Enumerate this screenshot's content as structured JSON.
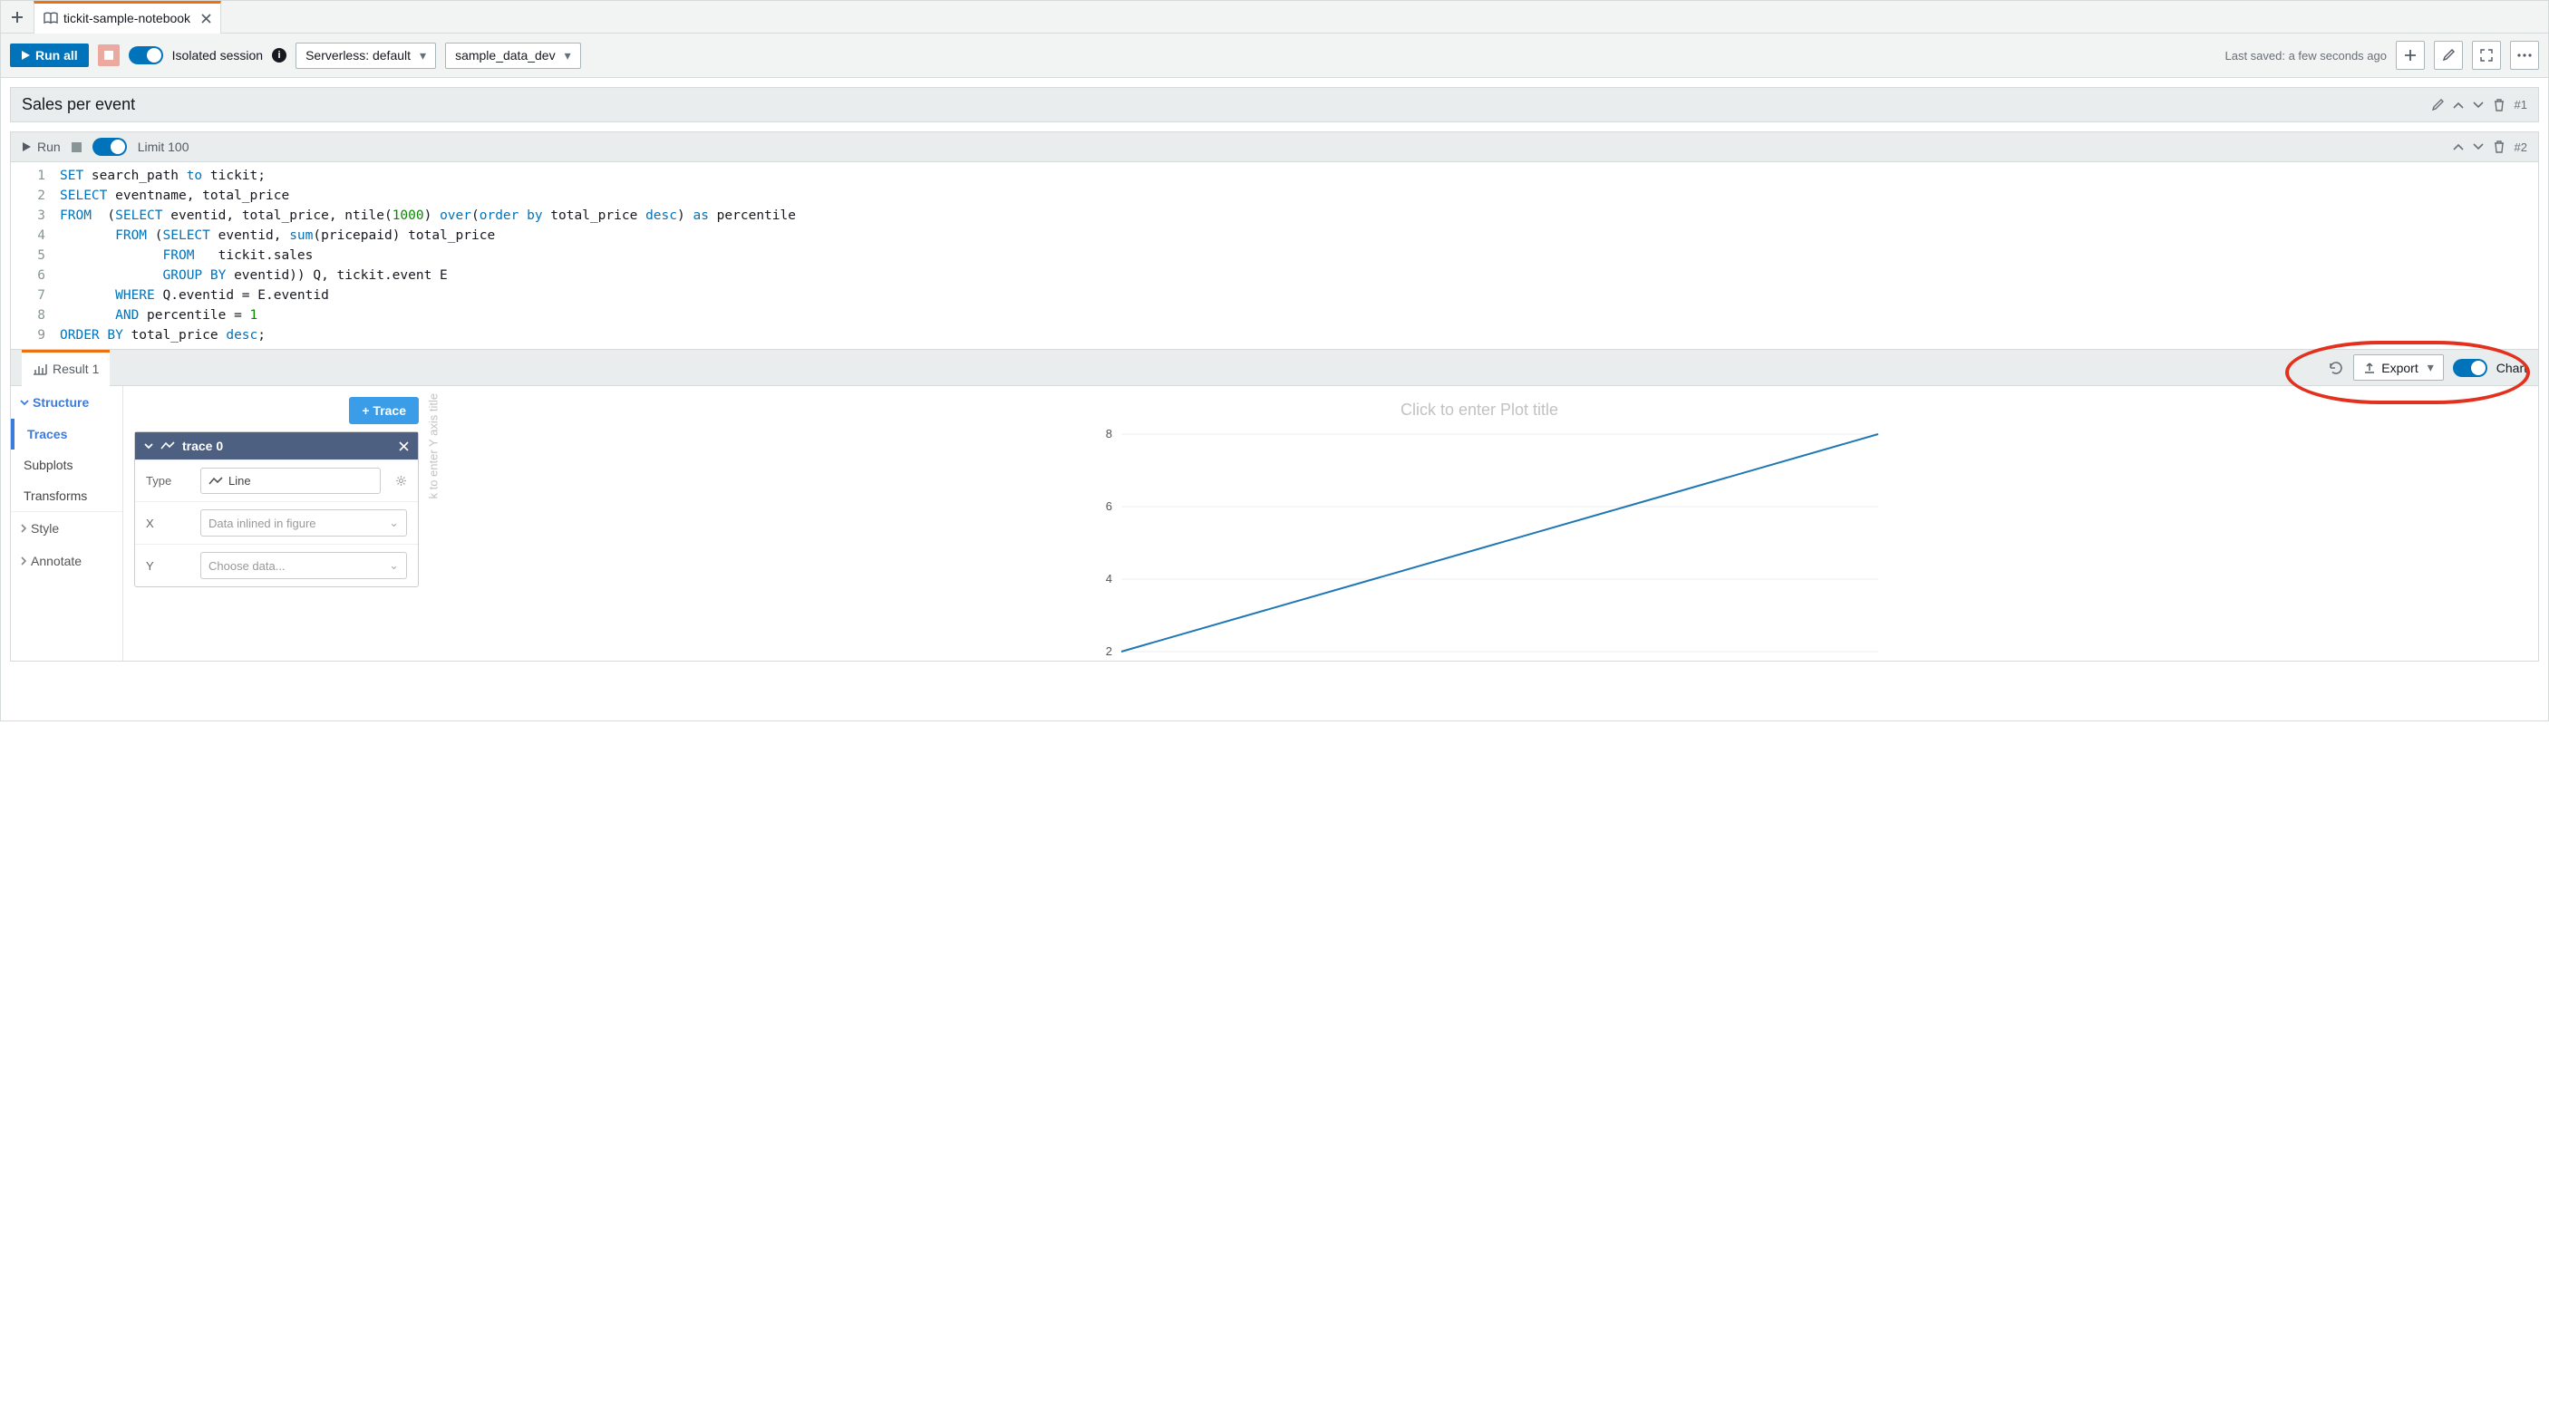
{
  "tab": {
    "name": "tickit-sample-notebook"
  },
  "toolbar": {
    "run_all": "Run all",
    "isolated_label": "Isolated session",
    "conn_select": "Serverless: default",
    "db_select": "sample_data_dev",
    "last_saved": "Last saved: a few seconds ago"
  },
  "cell1": {
    "title": "Sales per event",
    "number": "#1"
  },
  "cell2": {
    "run": "Run",
    "limit": "Limit 100",
    "number": "#2",
    "code": [
      [
        {
          "t": "SET",
          "c": "kw"
        },
        {
          "t": " search_path "
        },
        {
          "t": "to",
          "c": "kw"
        },
        {
          "t": " tickit;"
        }
      ],
      [
        {
          "t": "SELECT",
          "c": "kw"
        },
        {
          "t": " eventname, total_price"
        }
      ],
      [
        {
          "t": "FROM",
          "c": "kw"
        },
        {
          "t": "  ("
        },
        {
          "t": "SELECT",
          "c": "kw"
        },
        {
          "t": " eventid, total_price, ntile("
        },
        {
          "t": "1000",
          "c": "num-lit"
        },
        {
          "t": ") "
        },
        {
          "t": "over",
          "c": "kw"
        },
        {
          "t": "("
        },
        {
          "t": "order by",
          "c": "kw"
        },
        {
          "t": " total_price "
        },
        {
          "t": "desc",
          "c": "kw"
        },
        {
          "t": ") "
        },
        {
          "t": "as",
          "c": "kw"
        },
        {
          "t": " percentile"
        }
      ],
      [
        {
          "t": "       "
        },
        {
          "t": "FROM",
          "c": "kw"
        },
        {
          "t": " ("
        },
        {
          "t": "SELECT",
          "c": "kw"
        },
        {
          "t": " eventid, "
        },
        {
          "t": "sum",
          "c": "kw"
        },
        {
          "t": "(pricepaid) total_price"
        }
      ],
      [
        {
          "t": "             "
        },
        {
          "t": "FROM",
          "c": "kw"
        },
        {
          "t": "   tickit.sales"
        }
      ],
      [
        {
          "t": "             "
        },
        {
          "t": "GROUP BY",
          "c": "kw"
        },
        {
          "t": " eventid)) Q, tickit.event E"
        }
      ],
      [
        {
          "t": "       "
        },
        {
          "t": "WHERE",
          "c": "kw"
        },
        {
          "t": " Q.eventid = E.eventid"
        }
      ],
      [
        {
          "t": "       "
        },
        {
          "t": "AND",
          "c": "kw"
        },
        {
          "t": " percentile = "
        },
        {
          "t": "1",
          "c": "num-lit"
        }
      ],
      [
        {
          "t": "ORDER BY",
          "c": "kw"
        },
        {
          "t": " total_price "
        },
        {
          "t": "desc",
          "c": "kw"
        },
        {
          "t": ";"
        }
      ]
    ]
  },
  "results": {
    "tab_label": "Result 1",
    "export": "Export",
    "chart_toggle": "Chart"
  },
  "chart_sidebar": {
    "structure": "Structure",
    "traces": "Traces",
    "subplots": "Subplots",
    "transforms": "Transforms",
    "style": "Style",
    "annotate": "Annotate"
  },
  "trace_panel": {
    "add_trace": "+ Trace",
    "trace_name": "trace 0",
    "type_label": "Type",
    "type_value": "Line",
    "x_label": "X",
    "x_value": "Data inlined in figure",
    "y_label": "Y",
    "y_value": "Choose data..."
  },
  "plot": {
    "title_placeholder": "Click to enter Plot title",
    "y_axis_placeholder": "k to enter Y axis title"
  },
  "chart_data": {
    "type": "line",
    "title": "",
    "xlabel": "",
    "ylabel": "",
    "ylim": [
      2,
      8
    ],
    "x": [
      0,
      1,
      2,
      3
    ],
    "series": [
      {
        "name": "trace 0",
        "values": [
          2,
          4,
          6,
          8
        ]
      }
    ],
    "y_ticks": [
      2,
      4,
      6,
      8
    ]
  }
}
